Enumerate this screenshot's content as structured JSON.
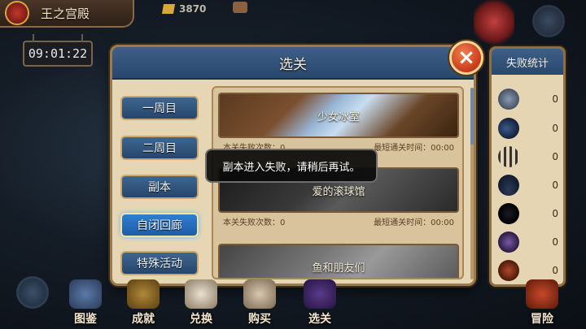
{
  "hud": {
    "location": "王之宫殿",
    "clock": "09:01:22",
    "gold": "3870"
  },
  "dialog": {
    "title": "选关",
    "close_icon": "×",
    "tabs": [
      "一周目",
      "二周目",
      "副本",
      "自闭回廊",
      "特殊活动"
    ],
    "active_tab": "自闭回廊",
    "stages": [
      {
        "name": "少女冰室",
        "fail_label": "本关失败次数：0",
        "time_label": "最短通关时间：00:00"
      },
      {
        "name": "爱的滚球馆",
        "fail_label": "本关失败次数：0",
        "time_label": "最短通关时间：00:00"
      },
      {
        "name": "鱼和朋友们",
        "fail_label": "",
        "time_label": ""
      }
    ]
  },
  "toast": "副本进入失败，请稍后再试。",
  "stats": {
    "title": "失败统计",
    "rows": [
      {
        "monster": "ball-monster-icon",
        "count": "0"
      },
      {
        "monster": "fish-monster-icon",
        "count": "0"
      },
      {
        "monster": "spikes-monster-icon",
        "count": "0"
      },
      {
        "monster": "shark-monster-icon",
        "count": "0"
      },
      {
        "monster": "ghost-monster-icon",
        "count": "0"
      },
      {
        "monster": "crab-monster-icon",
        "count": "0"
      },
      {
        "monster": "fire-monster-icon",
        "count": "0"
      }
    ]
  },
  "bottom_nav": [
    "图鉴",
    "成就",
    "兑换",
    "购买",
    "选关",
    "冒险"
  ]
}
